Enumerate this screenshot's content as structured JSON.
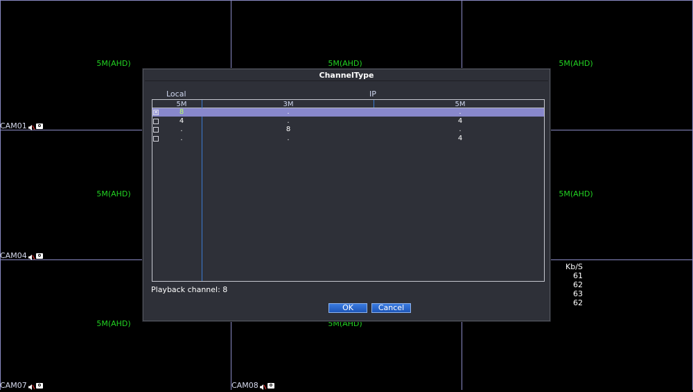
{
  "cameras": [
    {
      "name": "CAM01"
    },
    {
      "name": "CAM04"
    },
    {
      "name": "CAM07"
    },
    {
      "name": "CAM08"
    }
  ],
  "tile_labels": [
    "5M(AHD)",
    "5M(AHD)",
    "5M(AHD)",
    "5M(AHD)",
    "5M(AHD)",
    "5M(AHD)",
    "5M(AHD)"
  ],
  "bitrate": {
    "header": "Kb/S",
    "values": [
      "61",
      "62",
      "63",
      "62"
    ]
  },
  "dialog": {
    "title": "ChannelType",
    "group_local": "Local",
    "group_ip": "IP",
    "columns": [
      "5M",
      "3M",
      "5M"
    ],
    "rows": [
      {
        "checked": true,
        "local": "8",
        "ip3m": ".",
        "ip5m": "."
      },
      {
        "checked": false,
        "local": "4",
        "ip3m": ".",
        "ip5m": "4"
      },
      {
        "checked": false,
        "local": ".",
        "ip3m": "8",
        "ip5m": "."
      },
      {
        "checked": false,
        "local": ".",
        "ip3m": ".",
        "ip5m": "4"
      }
    ],
    "playback_text": "Playback channel: 8",
    "ok_label": "OK",
    "cancel_label": "Cancel"
  },
  "colors": {
    "accent_green": "#22d422",
    "selection": "#8888cc",
    "button": "#1e56b8"
  }
}
